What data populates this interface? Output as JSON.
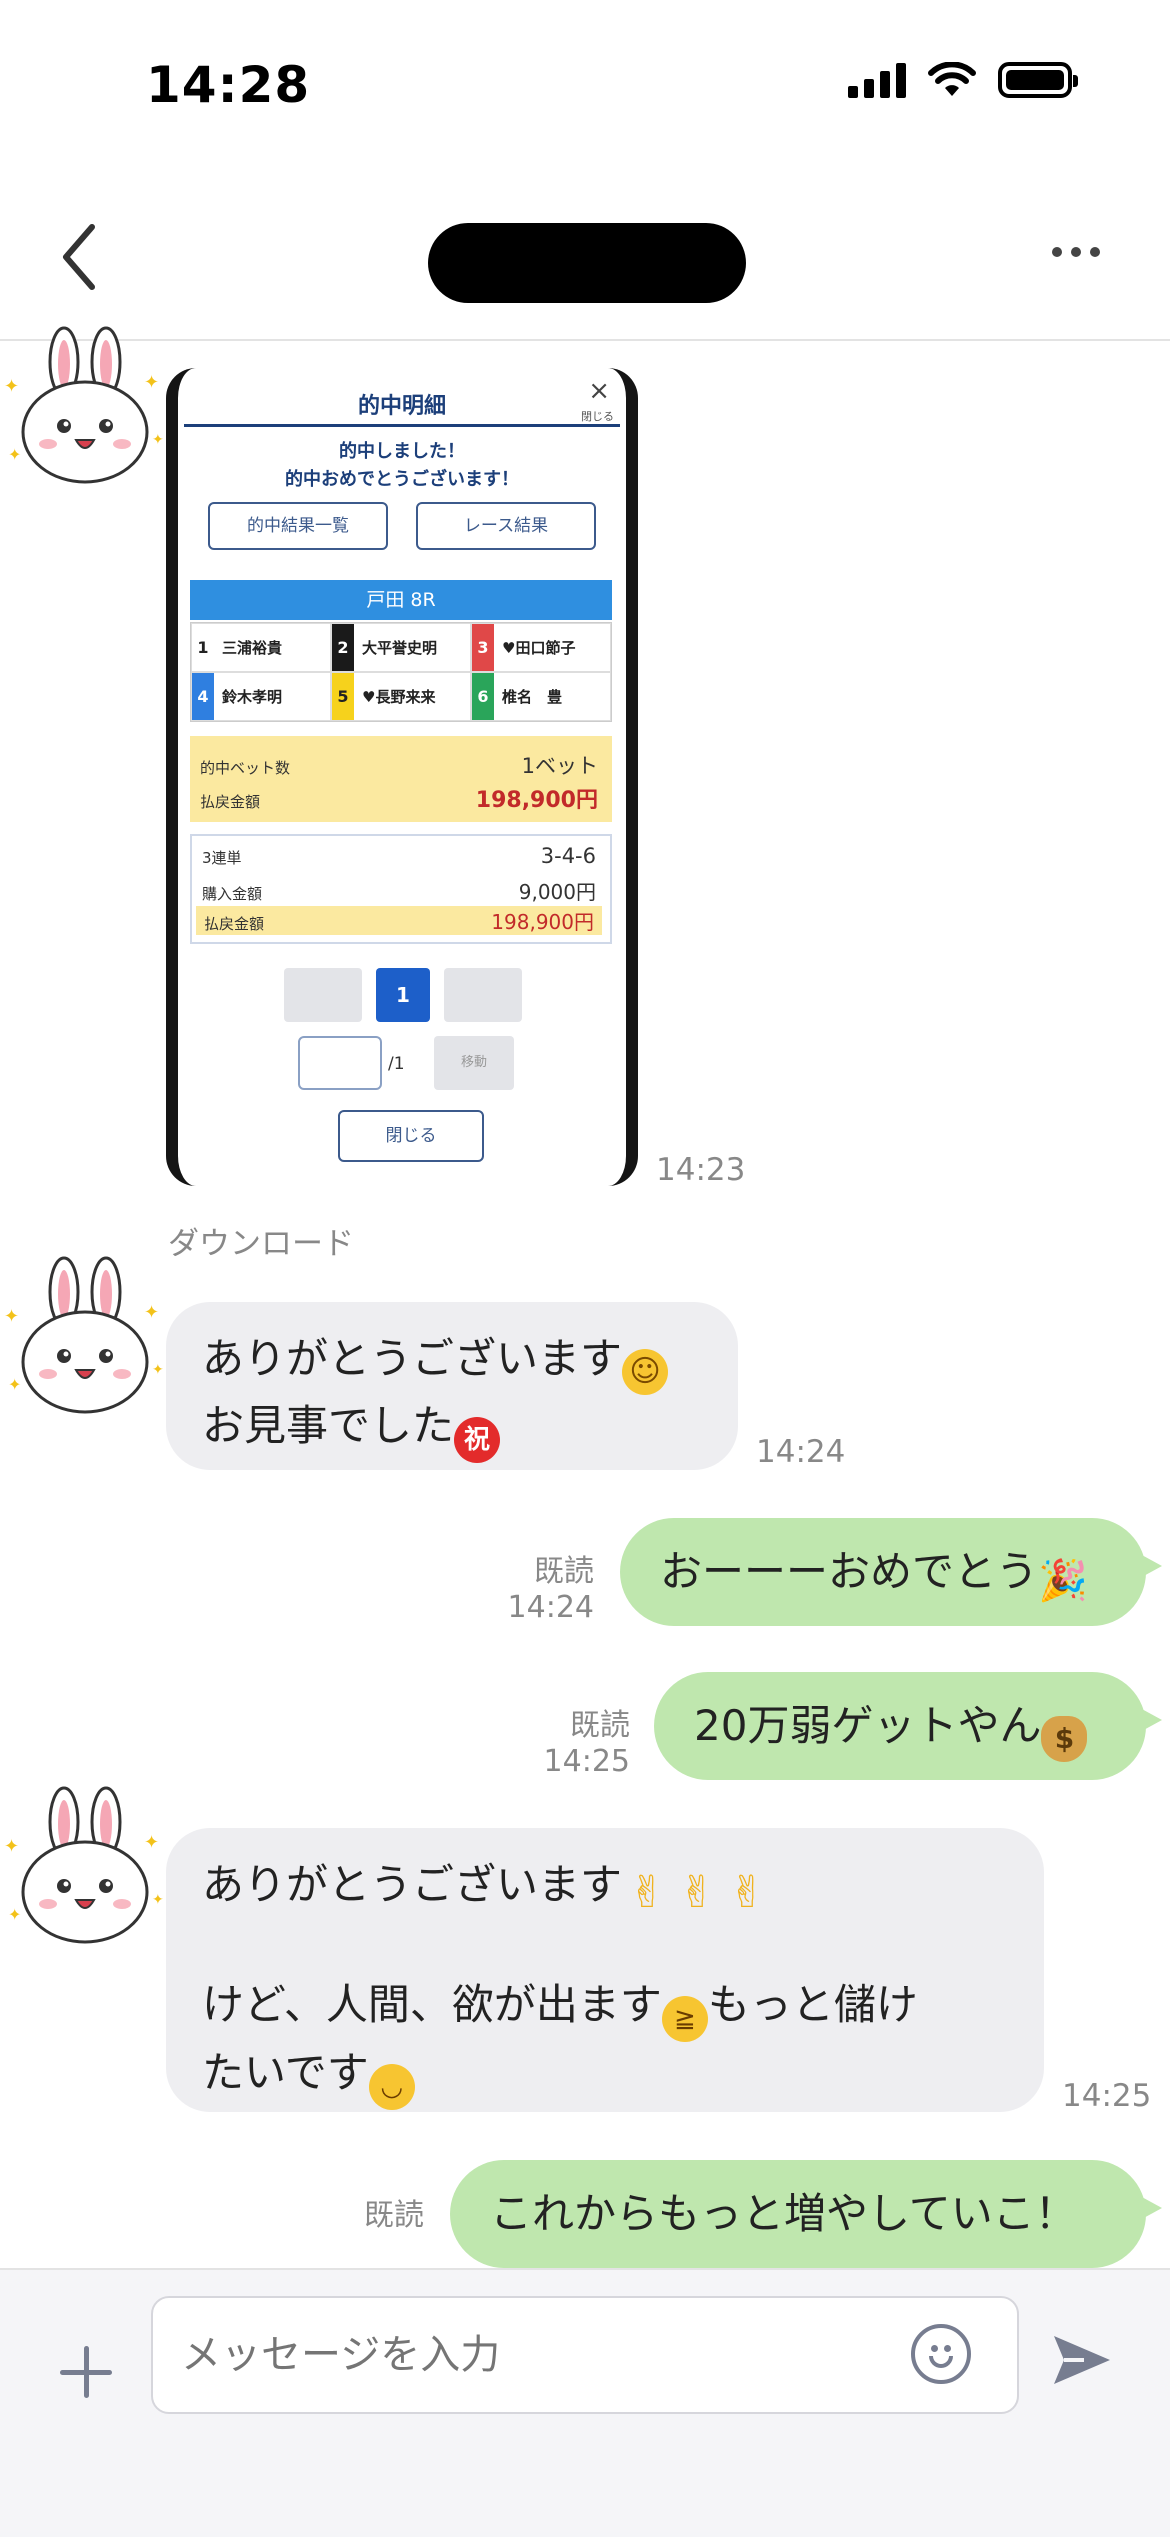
{
  "status_bar": {
    "time": "14:28"
  },
  "header": {
    "title": ""
  },
  "screenshot": {
    "title": "的中明細",
    "close_x": "×",
    "close_label": "閉じる",
    "message_line1": "的中しました！",
    "message_line2": "的中おめでとうございます！",
    "btn_results_list": "的中結果一覧",
    "btn_race_result": "レース結果",
    "race_name": "戸田 8R",
    "racers": [
      {
        "num": "1",
        "name": "三浦裕貴",
        "num_bg": "#ffffff",
        "num_color": "#222222"
      },
      {
        "num": "2",
        "name": "大平誉史明",
        "num_bg": "#1a1a1a",
        "num_color": "#ffffff"
      },
      {
        "num": "3",
        "name": "♥田口節子",
        "num_bg": "#e04848",
        "num_color": "#ffffff"
      },
      {
        "num": "4",
        "name": "鈴木孝明",
        "num_bg": "#2f7fe0",
        "num_color": "#ffffff"
      },
      {
        "num": "5",
        "name": "♥長野来来",
        "num_bg": "#f6d21c",
        "num_color": "#222222"
      },
      {
        "num": "6",
        "name": "椎名　豊",
        "num_bg": "#2aa55a",
        "num_color": "#ffffff"
      }
    ],
    "hit_bets_label": "的中ベット数",
    "hit_bets_value": "1ベット",
    "payout_label": "払戻金額",
    "payout_value": "198,900円",
    "bet_type_label": "3連単",
    "bet_type_value": "3-4-6",
    "purchase_label": "購入金額",
    "purchase_value": "9,000円",
    "payout2_label": "払戻金額",
    "payout2_value": "198,900円",
    "page_current": "1",
    "page_total": "/1",
    "move_label": "移動",
    "close_button": "閉じる"
  },
  "messages": {
    "image_time": "14:23",
    "download_label": "ダウンロード",
    "m1_line1": "ありがとうございます",
    "m1_line2": "お見事でした",
    "m1_emoji_iwai": "祝",
    "m1_time": "14:24",
    "m2_text": "おーーーおめでとう",
    "m2_read": "既読",
    "m2_time": "14:24",
    "m3_text": "20万弱ゲットやん",
    "m3_read": "既読",
    "m3_time": "14:25",
    "m4_line1": "ありがとうございます",
    "m4_line3a": "けど、人間、欲が出ます",
    "m4_line3b": "もっと儲け",
    "m4_line4": "たいです",
    "m4_time": "14:25",
    "m5_text": "これからもっと増やしていこ！",
    "m5_read": "既読"
  },
  "input": {
    "placeholder": "メッセージを入力"
  },
  "colors": {
    "outgoing_bubble": "#bfe7ae",
    "incoming_bubble": "#eeeef1",
    "icon_gray": "#777d90"
  },
  "icons": [
    "back-chevron-icon",
    "more-icon",
    "plus-icon",
    "emoji-icon",
    "send-icon",
    "cony-avatar"
  ]
}
